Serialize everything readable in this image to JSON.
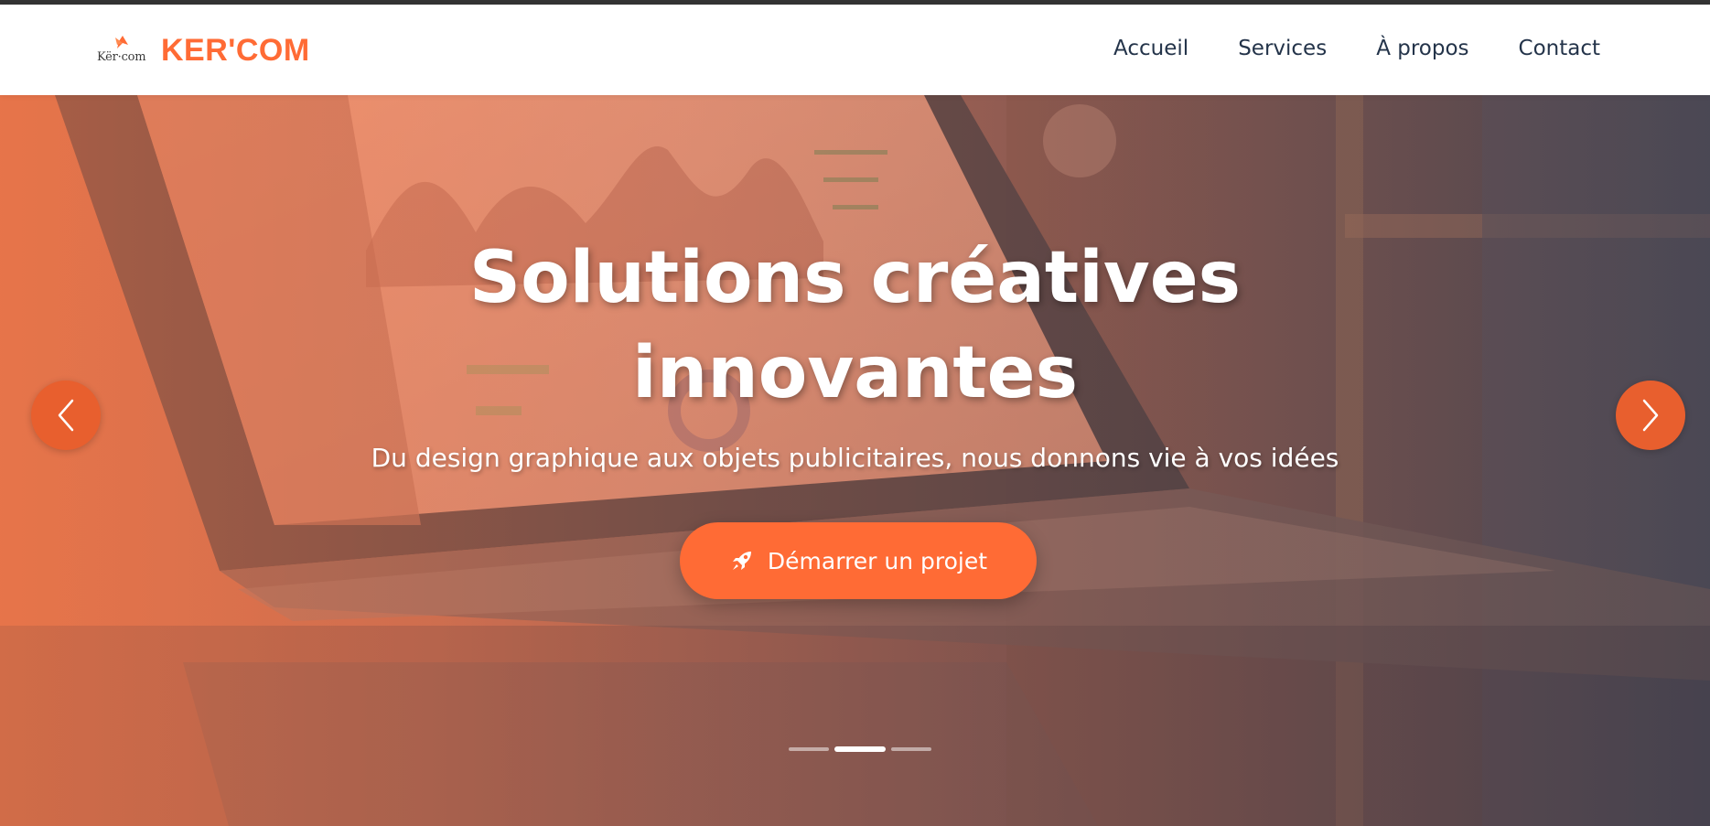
{
  "brand": {
    "logo_text": "Kër·com",
    "name": "KER'COM",
    "color": "#ff6b35"
  },
  "nav": {
    "items": [
      {
        "label": "Accueil"
      },
      {
        "label": "Services"
      },
      {
        "label": "À propos"
      },
      {
        "label": "Contact"
      }
    ]
  },
  "hero": {
    "title_line1": "Solutions créatives",
    "title_line2": "innovantes",
    "subtitle": "Du design graphique aux objets publicitaires, nous donnons vie à vos idées",
    "cta_label": "Démarrer un projet",
    "cta_icon": "rocket-icon",
    "accent": "#ff6b35"
  },
  "carousel": {
    "prev_icon": "chevron-left-icon",
    "next_icon": "chevron-right-icon",
    "slide_count": 3,
    "active_slide": 2
  }
}
